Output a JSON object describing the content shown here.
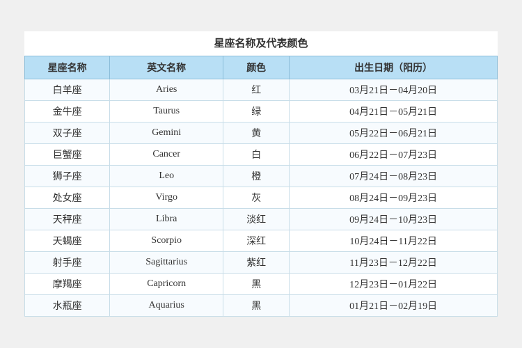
{
  "title": "星座名称及代表颜色",
  "headers": {
    "chinese": "星座名称",
    "english": "英文名称",
    "color": "颜色",
    "date": "出生日期（阳历）"
  },
  "rows": [
    {
      "chinese": "白羊座",
      "english": "Aries",
      "color": "红",
      "date": "03月21日－04月20日"
    },
    {
      "chinese": "金牛座",
      "english": "Taurus",
      "color": "绿",
      "date": "04月21日－05月21日"
    },
    {
      "chinese": "双子座",
      "english": "Gemini",
      "color": "黄",
      "date": "05月22日－06月21日"
    },
    {
      "chinese": "巨蟹座",
      "english": "Cancer",
      "color": "白",
      "date": "06月22日－07月23日"
    },
    {
      "chinese": "狮子座",
      "english": "Leo",
      "color": "橙",
      "date": "07月24日－08月23日"
    },
    {
      "chinese": "处女座",
      "english": "Virgo",
      "color": "灰",
      "date": "08月24日－09月23日"
    },
    {
      "chinese": "天秤座",
      "english": "Libra",
      "color": "淡红",
      "date": "09月24日－10月23日"
    },
    {
      "chinese": "天蝎座",
      "english": "Scorpio",
      "color": "深红",
      "date": "10月24日－11月22日"
    },
    {
      "chinese": "射手座",
      "english": "Sagittarius",
      "color": "紫红",
      "date": "11月23日－12月22日"
    },
    {
      "chinese": "摩羯座",
      "english": "Capricorn",
      "color": "黑",
      "date": "12月23日－01月22日"
    },
    {
      "chinese": "水瓶座",
      "english": "Aquarius",
      "color": "黑",
      "date": "01月21日－02月19日"
    }
  ]
}
